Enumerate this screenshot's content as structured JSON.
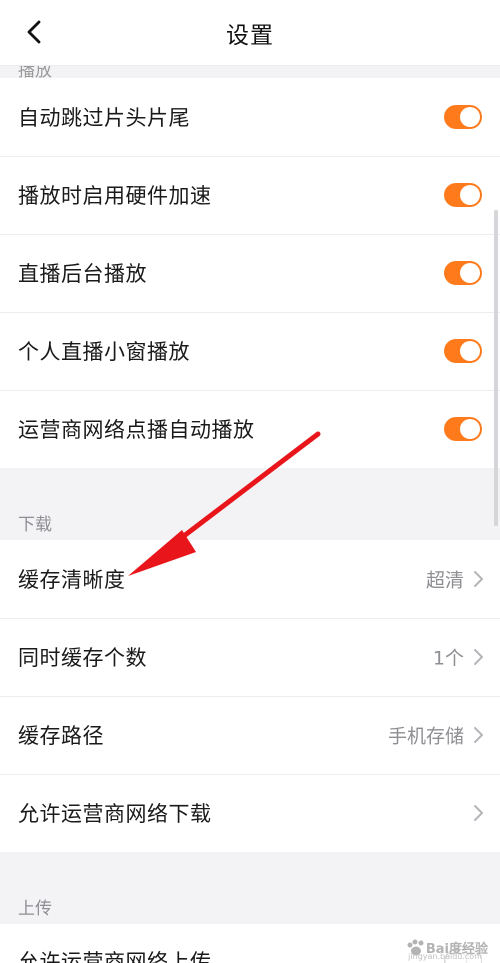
{
  "header": {
    "title": "设置"
  },
  "playback": {
    "items": [
      {
        "label": "自动跳过片头片尾",
        "enabled": true
      },
      {
        "label": "播放时启用硬件加速",
        "enabled": true
      },
      {
        "label": "直播后台播放",
        "enabled": true
      },
      {
        "label": "个人直播小窗播放",
        "enabled": true
      },
      {
        "label": "运营商网络点播自动播放",
        "enabled": true
      }
    ]
  },
  "download": {
    "title": "下载",
    "items": [
      {
        "label": "缓存清晰度",
        "value": "超清"
      },
      {
        "label": "同时缓存个数",
        "value": "1个"
      },
      {
        "label": "缓存路径",
        "value": "手机存储"
      },
      {
        "label": "允许运营商网络下载",
        "value": ""
      }
    ]
  },
  "upload": {
    "title": "上传",
    "items": [
      {
        "label": "允许运营商网络上传",
        "enabled": false
      }
    ]
  },
  "colors": {
    "accent": "#ff7a1a",
    "arrow": "#e8161a"
  },
  "watermark": {
    "text": "Bai度经验",
    "sub": "jingyan.baidu.com"
  }
}
